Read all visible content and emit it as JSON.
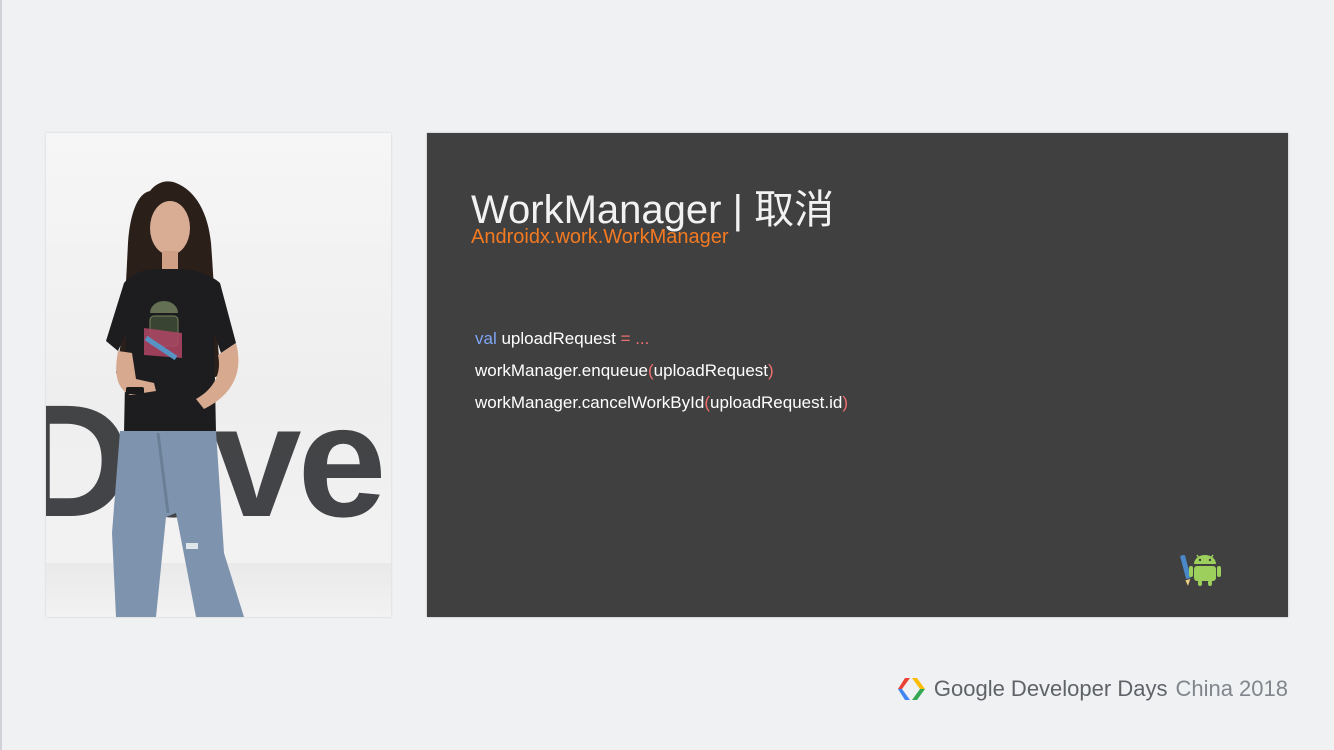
{
  "video": {
    "backdrop_text": "Deve"
  },
  "slide": {
    "title": "WorkManager | 取消",
    "subtitle": "Androidx.work.WorkManager",
    "code": {
      "line1": {
        "keyword": "val",
        "ident": " uploadRequest ",
        "op": "= ..."
      },
      "line2": {
        "ident1": "workManager",
        "dot": ".",
        "ident2": "enqueue",
        "paren_open": "(",
        "arg": "uploadRequest",
        "paren_close": ")"
      },
      "line3": {
        "ident1": "workManager",
        "dot": ".",
        "ident2": "cancelWorkById",
        "paren_open": "(",
        "arg": "uploadRequest.id",
        "paren_close": ")"
      }
    },
    "badge_icon": "android-robot-icon"
  },
  "footer": {
    "logo_icon": "google-developers-chevrons-icon",
    "brand": "Google Developer Days",
    "edition": "China 2018"
  },
  "colors": {
    "slide_bg": "#404040",
    "subtitle": "#f47a21",
    "keyword": "#7ea5f5",
    "operator": "#ef6f6f"
  }
}
